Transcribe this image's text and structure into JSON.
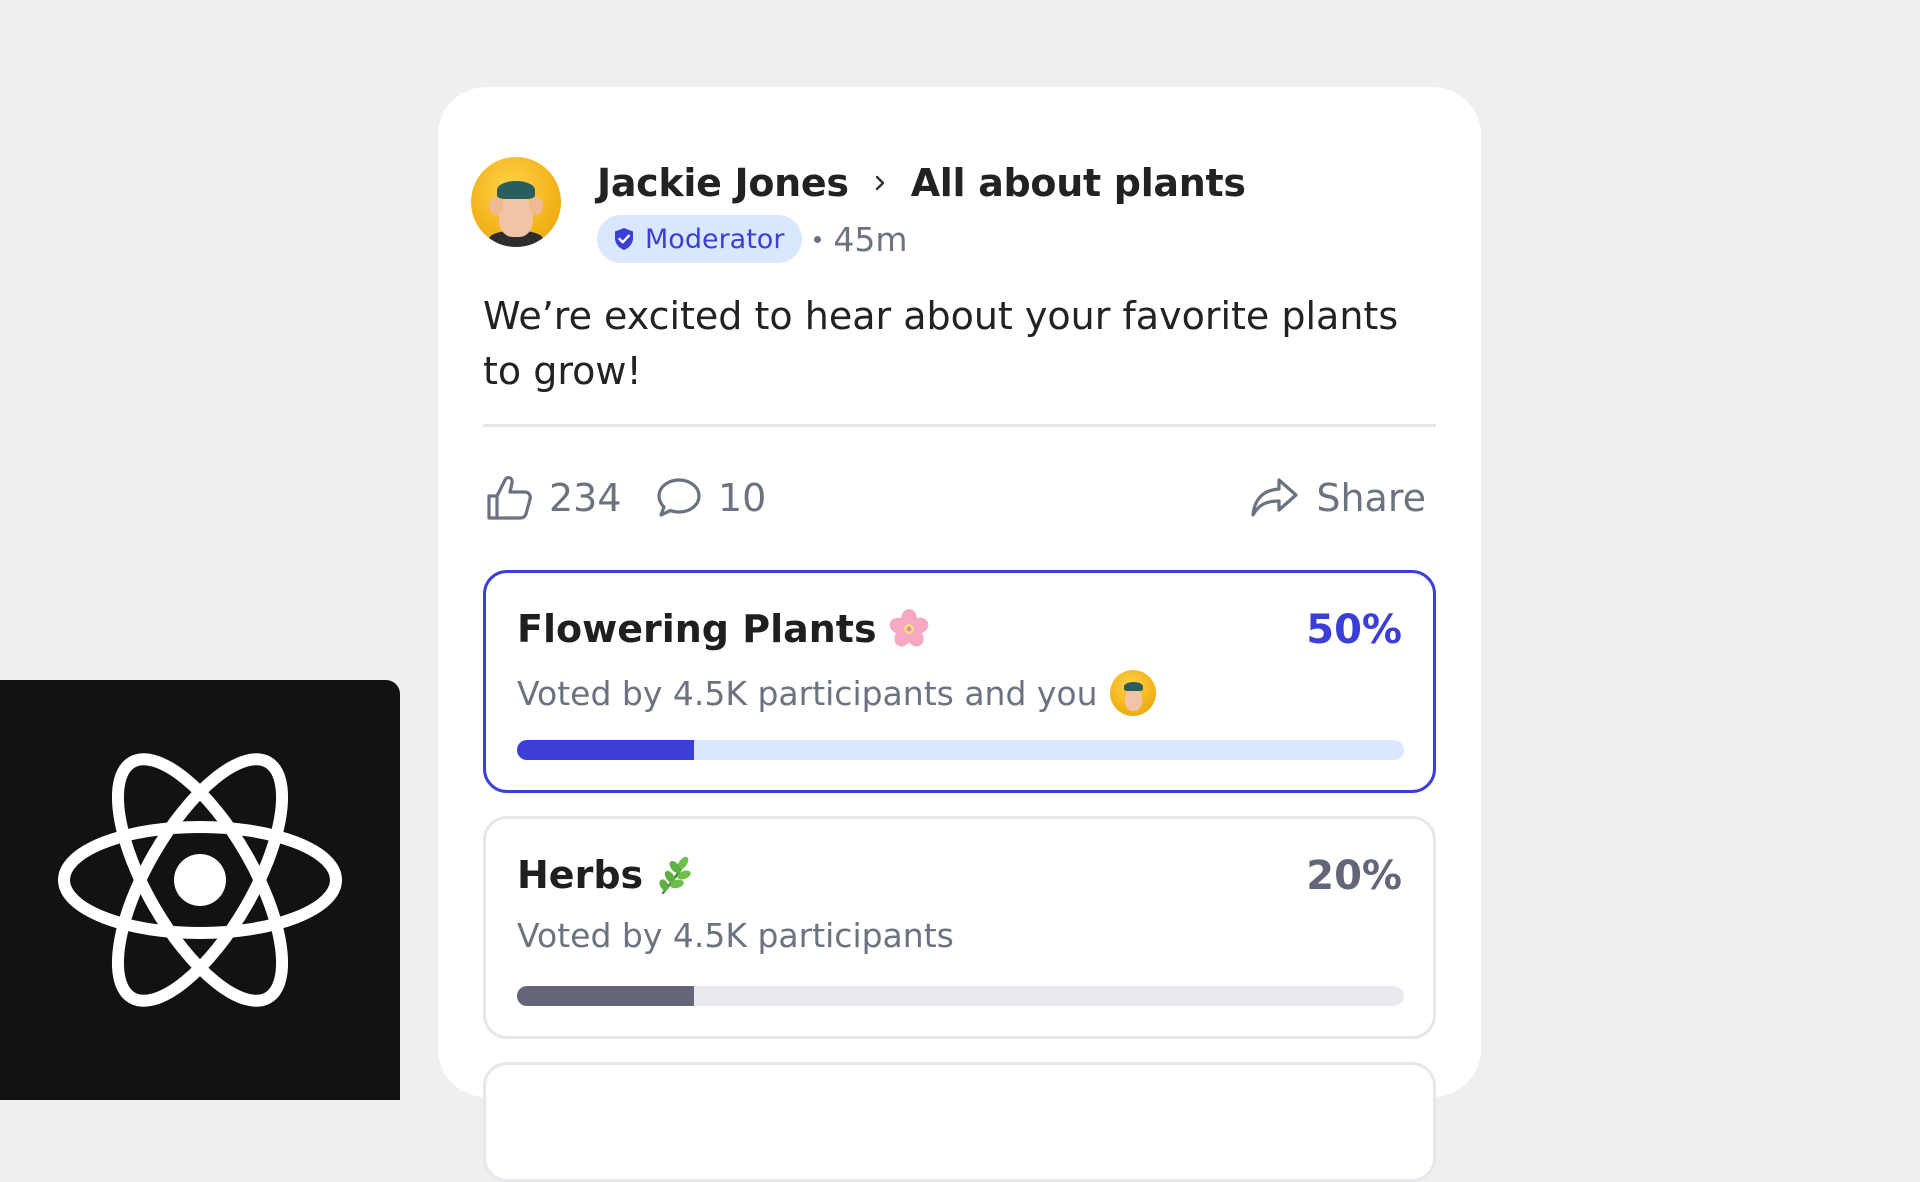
{
  "post": {
    "author": "Jackie Jones",
    "community": "All about plants",
    "role_badge": "Moderator",
    "time_ago": "45m",
    "text": "We’re excited to hear about your favorite plants to grow!",
    "likes": "234",
    "comments": "10",
    "share_label": "Share"
  },
  "poll": {
    "options": [
      {
        "title": "Flowering Plants",
        "emoji_icon": "cherry-blossom-icon",
        "percent_label": "50%",
        "percent_value": 50,
        "fill_fraction": 0.2,
        "subtitle": "Voted by 4.5K participants and you",
        "selected": true
      },
      {
        "title": "Herbs",
        "emoji_icon": "herb-icon",
        "percent_label": "20%",
        "percent_value": 20,
        "fill_fraction": 0.2,
        "subtitle": "Voted by 4.5K participants",
        "selected": false
      }
    ]
  },
  "colors": {
    "accent": "#3b3fd8",
    "badge_bg": "#dbe7ff",
    "track_selected": "#dbe7ff",
    "track_normal": "#e9eaee",
    "fill_normal": "#636678",
    "muted_text": "#6b7280"
  },
  "overlay": {
    "logo_icon": "react-logo-icon"
  }
}
